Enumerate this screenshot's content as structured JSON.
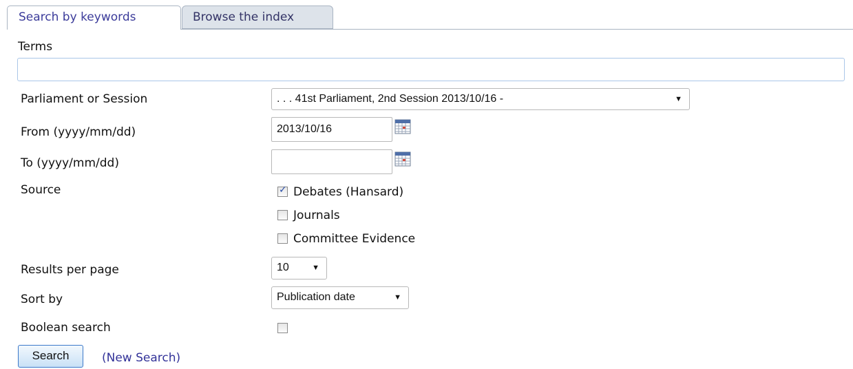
{
  "tabs": [
    {
      "label": "Search by keywords"
    },
    {
      "label": "Browse the index"
    }
  ],
  "terms": {
    "label": "Terms",
    "value": ""
  },
  "parliament": {
    "label": "Parliament or Session",
    "selected": ". . . 41st Parliament, 2nd Session 2013/10/16 -"
  },
  "from": {
    "label": "From (yyyy/mm/dd)",
    "value": "2013/10/16"
  },
  "to": {
    "label": "To (yyyy/mm/dd)",
    "value": ""
  },
  "source": {
    "label": "Source",
    "options": [
      {
        "label": "Debates (Hansard)",
        "checked": true
      },
      {
        "label": "Journals",
        "checked": false
      },
      {
        "label": "Committee Evidence",
        "checked": false
      }
    ]
  },
  "results_per_page": {
    "label": "Results per page",
    "selected": "10"
  },
  "sort_by": {
    "label": "Sort by",
    "selected": "Publication date"
  },
  "boolean_search": {
    "label": "Boolean search",
    "checked": false
  },
  "actions": {
    "search_label": "Search",
    "new_search_label": "(New Search)"
  },
  "icons": {
    "calendar": "calendar-icon",
    "dropdown": "chevron-down-icon",
    "check": "checkmark-icon"
  }
}
